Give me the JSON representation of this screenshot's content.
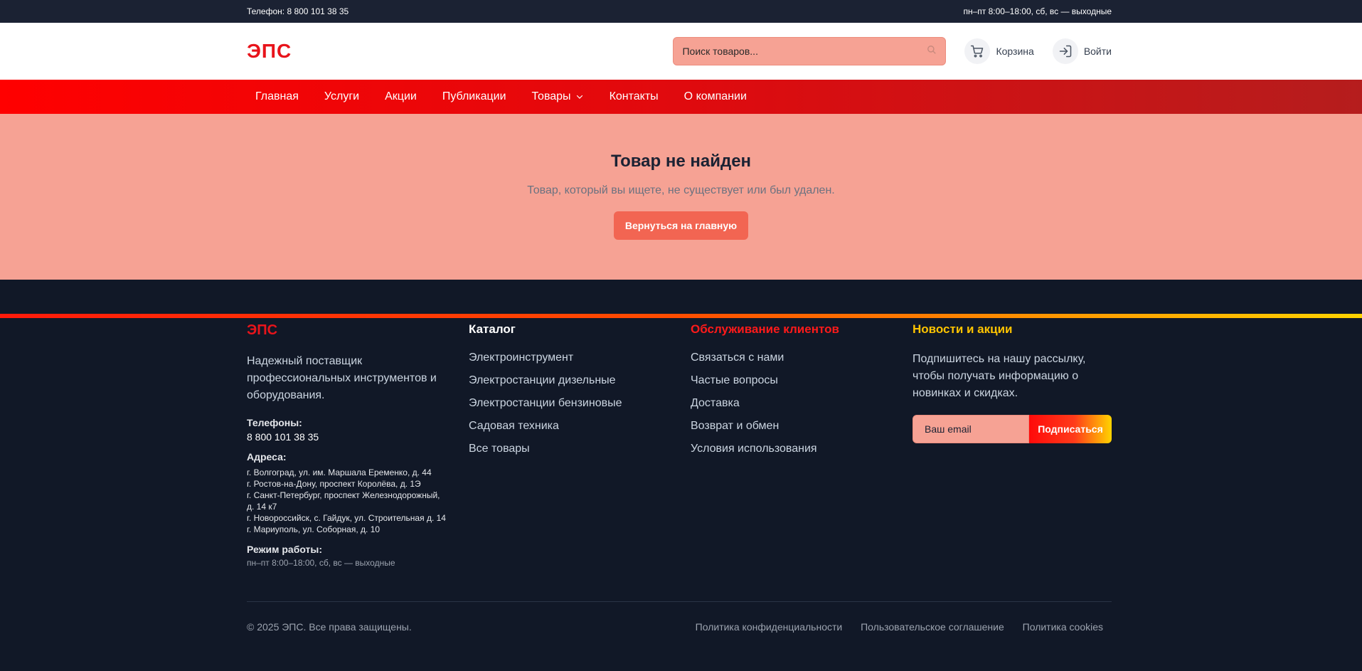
{
  "topbar": {
    "phone": "Телефон: 8 800 101 38 35",
    "hours": "пн–пт 8:00–18:00, сб, вс — выходные"
  },
  "header": {
    "logo": "ЭПС",
    "search_placeholder": "Поиск товаров...",
    "cart_label": "Корзина",
    "login_label": "Войти"
  },
  "nav": {
    "items": [
      "Главная",
      "Услуги",
      "Акции",
      "Публикации",
      "Товары",
      "Контакты",
      "О компании"
    ]
  },
  "hero": {
    "title": "Товар не найден",
    "subtitle": "Товар, который вы ищете, не существует или был удален.",
    "button": "Вернуться на главную"
  },
  "footer": {
    "brand": {
      "title": "ЭПС",
      "description": "Надежный поставщик профессиональных инструментов и оборудования.",
      "phones_label": "Телефоны:",
      "phone": "8 800 101 38 35",
      "addresses_label": "Адреса:",
      "addresses": [
        "г. Волгоград, ул. им. Маршала Еременко, д. 44",
        "г. Ростов-на-Дону, проспект Королёва, д. 1Э",
        "г. Санкт-Петербург, проспект Железнодорожный, д. 14 к7",
        "г. Новороссийск, с. Гайдук, ул. Строительная д. 14",
        "г. Мариуполь, ул. Соборная, д. 10"
      ],
      "hours_label": "Режим работы:",
      "hours": "пн–пт 8:00–18:00, сб, вс — выходные"
    },
    "catalog": {
      "title": "Каталог",
      "items": [
        "Электроинструмент",
        "Электростанции дизельные",
        "Электростанции бензиновые",
        "Садовая техника",
        "Все товары"
      ]
    },
    "service": {
      "title": "Обслуживание клиентов",
      "items": [
        "Связаться с нами",
        "Частые вопросы",
        "Доставка",
        "Возврат и обмен",
        "Условия использования"
      ]
    },
    "news": {
      "title": "Новости и акции",
      "description": "Подпишитесь на нашу рассылку, чтобы получать информацию о новинках и скидках.",
      "email_placeholder": "Ваш email",
      "subscribe_button": "Подписаться"
    },
    "copyright": "© 2025 ЭПС. Все права защищены.",
    "legal_links": [
      "Политика конфиденциальности",
      "Пользовательское соглашение",
      "Политика cookies"
    ]
  },
  "colors": {
    "brand_red": "#e8141b",
    "dark": "#1b2233",
    "salmon": "#f6a294",
    "button": "#f26552",
    "service_title": "#ff1a1a",
    "news_title": "#ffc400"
  }
}
